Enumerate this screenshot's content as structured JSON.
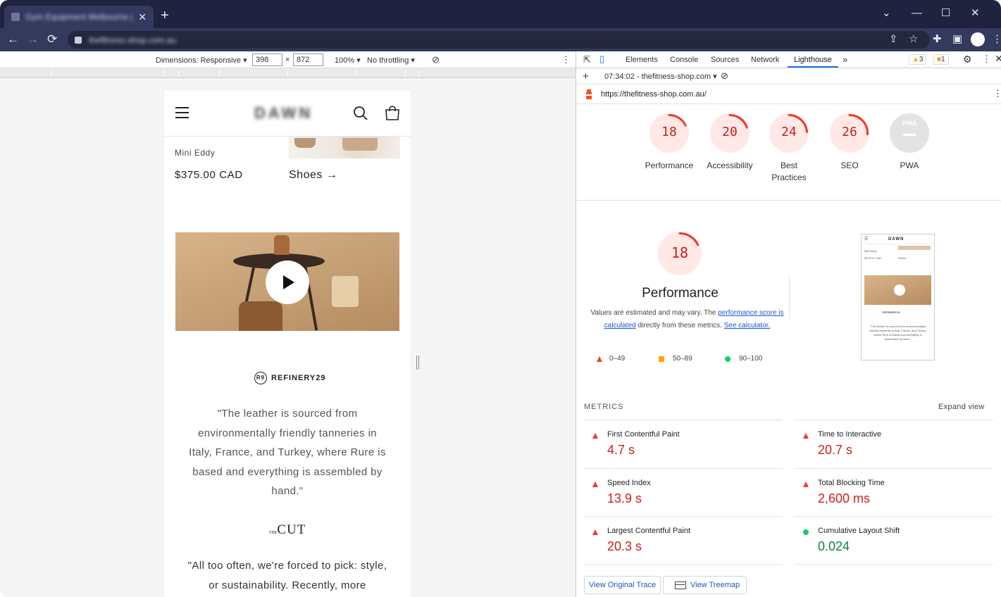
{
  "browser": {
    "tab_title": "Gym Equipment Melbourne (Po",
    "tab_close": "✕",
    "new_tab": "+",
    "url": "thefitness-shop.com.au",
    "window": {
      "minimize": "—",
      "maximize": "☐",
      "close": "✕",
      "tab_list": "⌄"
    }
  },
  "device_toolbar": {
    "dimensions": "Dimensions: Responsive ▾",
    "width": "398",
    "times": "×",
    "height": "872",
    "zoom": "100% ▾",
    "throttling": "No throttling ▾"
  },
  "page": {
    "brand": "DAWN",
    "product_name": "Mini Eddy",
    "price": "$375.00 CAD",
    "shoes_link": "Shoes →",
    "press1_logo": "REFINERY29",
    "press1_mark": "R9",
    "quote1": "\"The leather is sourced from environmentally friendly tanneries in Italy, France, and Turkey, where Rure is based and everything is assembled by hand.\"",
    "press2_small": "THE",
    "press2_logo": "CUT",
    "quote2": "\"All too often, we're forced to pick: style, or sustainability. Recently, more"
  },
  "devtools": {
    "tabs": [
      "Elements",
      "Console",
      "Sources",
      "Network",
      "Lighthouse"
    ],
    "more": "»",
    "warnings": "3",
    "issues": "1",
    "report_time": "07:34:02 - thefitness-shop.com ▾",
    "report_url": "https://thefitness-shop.com.au/",
    "gauges": [
      {
        "score": "18",
        "label": "Performance",
        "value": 0.18
      },
      {
        "score": "20",
        "label": "Accessibility",
        "value": 0.2
      },
      {
        "score": "24",
        "label": "Best Practices",
        "value": 0.24
      },
      {
        "score": "26",
        "label": "SEO",
        "value": 0.26
      }
    ],
    "pwa": {
      "label": "PWA",
      "badge": "PWA"
    },
    "perf": {
      "score": "18",
      "value": 0.18,
      "title": "Performance",
      "desc_start": "Values are estimated and may vary. The ",
      "desc_link1": "performance score is calculated",
      "desc_mid": " directly from these metrics. ",
      "desc_link2": "See calculator."
    },
    "legend": {
      "poor": "0–49",
      "average": "50–89",
      "good": "90–100"
    },
    "thumb": {
      "brand": "DAWN",
      "product": "Mini Eddy",
      "price": "$375.00 CAD",
      "shoes": "Shoes →",
      "press": "REFINERY29",
      "quote": "\"The leather is sourced from environmentally friendly tanneries in Italy, France, and Turkey, where Rure is based and everything is assembled by hand.\""
    },
    "metrics_title": "METRICS",
    "expand_view": "Expand view",
    "metrics": [
      {
        "name": "First Contentful Paint",
        "value": "4.7 s",
        "status": "poor"
      },
      {
        "name": "Time to Interactive",
        "value": "20.7 s",
        "status": "poor"
      },
      {
        "name": "Speed Index",
        "value": "13.9 s",
        "status": "poor"
      },
      {
        "name": "Total Blocking Time",
        "value": "2,600 ms",
        "status": "poor"
      },
      {
        "name": "Largest Contentful Paint",
        "value": "20.3 s",
        "status": "poor"
      },
      {
        "name": "Cumulative Layout Shift",
        "value": "0.024",
        "status": "good"
      }
    ],
    "buttons": {
      "trace": "View Original Trace",
      "treemap": "View Treemap"
    }
  },
  "colors": {
    "poor": "#eb3b2e",
    "average": "#ffa400",
    "good": "#0cce6b",
    "accent": "#1a73e8"
  }
}
